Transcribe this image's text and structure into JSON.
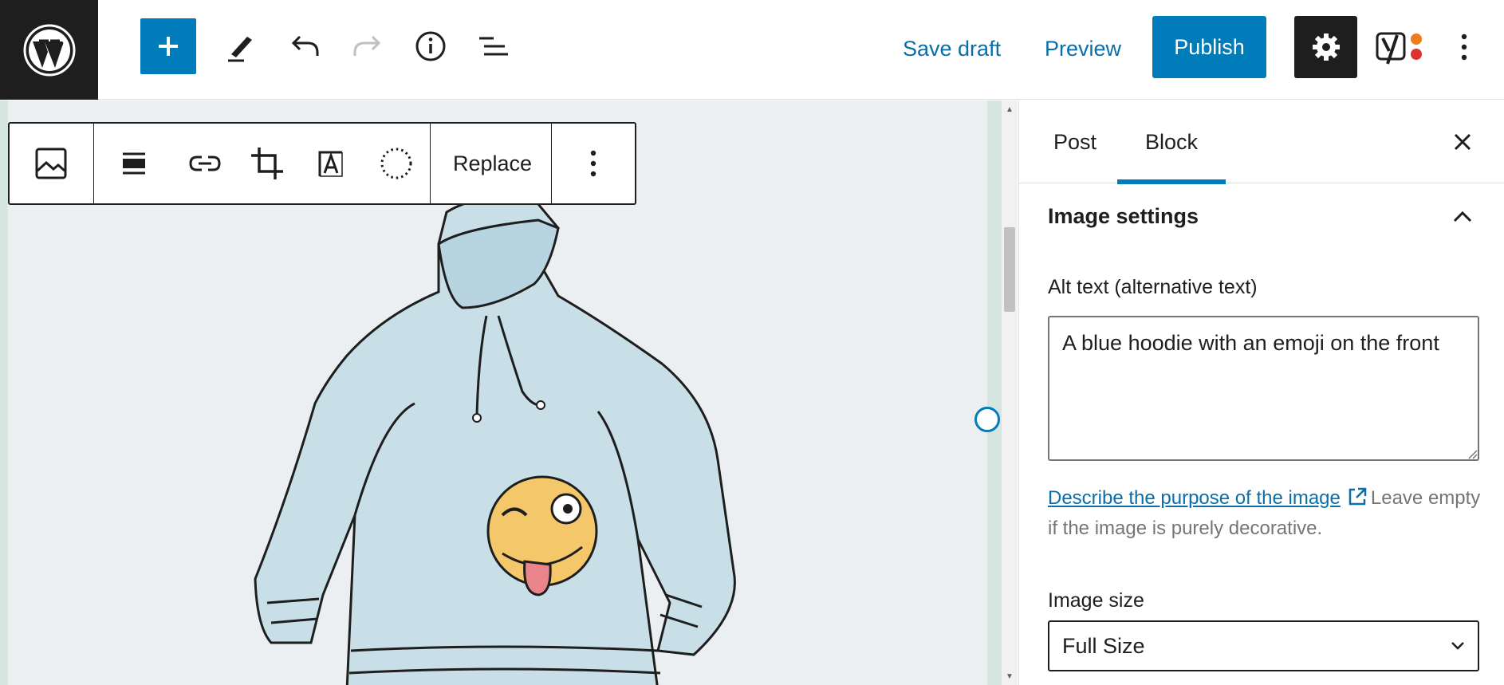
{
  "topbar": {
    "save_draft": "Save draft",
    "preview": "Preview",
    "publish": "Publish",
    "icons": [
      "wordpress-logo-icon",
      "plus-icon",
      "pencil-icon",
      "undo-icon",
      "redo-icon",
      "info-icon",
      "list-view-icon",
      "gear-icon",
      "yoast-icon",
      "more-vertical-icon"
    ]
  },
  "block_toolbar": {
    "replace": "Replace",
    "icons": [
      "image-icon",
      "align-icon",
      "link-icon",
      "crop-icon",
      "text-overlay-icon",
      "duotone-icon",
      "more-vertical-icon"
    ]
  },
  "sidebar": {
    "tabs": [
      {
        "label": "Post",
        "active": false
      },
      {
        "label": "Block",
        "active": true
      }
    ],
    "panel_title": "Image settings",
    "alt_label": "Alt text (alternative text)",
    "alt_value": "A blue hoodie with an emoji on the front",
    "help_link": "Describe the purpose of the image",
    "help_text": "Leave empty if the image is purely decorative.",
    "size_label": "Image size",
    "size_value": "Full Size"
  },
  "colors": {
    "accent": "#007cba",
    "dark": "#1e1e1e",
    "canvas": "#eceff1"
  }
}
